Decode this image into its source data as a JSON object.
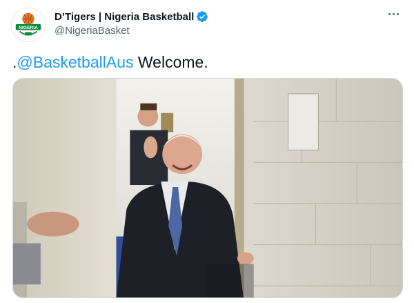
{
  "author": {
    "display_name": "D’Tigers | Nigeria Basketball",
    "handle": "@NigeriaBasket",
    "avatar_logo_text": "NIGERIA",
    "verified_icon": "verified-badge-icon"
  },
  "menu": {
    "icon": "more-options-icon"
  },
  "tweet": {
    "prefix": ".",
    "mention": "@BasketballAus",
    "suffix": " Welcome."
  },
  "media": {
    "type": "video-still",
    "description_icon": "media-video"
  },
  "colors": {
    "accent": "#1d9bf0",
    "text": "#0f1419",
    "secondary_text": "#536471",
    "border": "#cfd9de"
  }
}
